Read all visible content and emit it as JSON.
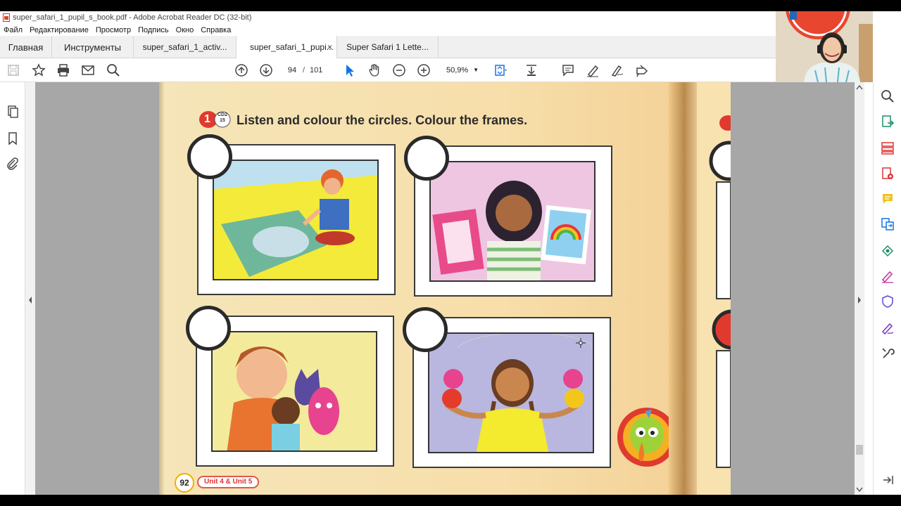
{
  "window": {
    "title": "super_safari_1_pupil_s_book.pdf - Adobe Acrobat Reader DC (32-bit)"
  },
  "menu": [
    "Файл",
    "Редактирование",
    "Просмотр",
    "Подпись",
    "Окно",
    "Справка"
  ],
  "tabs": {
    "home": "Главная",
    "tools": "Инструменты",
    "doc1": "super_safari_1_activ...",
    "doc2": "super_safari_1_pupi...",
    "doc2_close": "×",
    "doc3": "Super Safari 1 Lette..."
  },
  "toolbar": {
    "page_current": "94",
    "page_separator": "/",
    "page_total": "101",
    "zoom": "50,9%",
    "zoom_caret": "▼"
  },
  "page": {
    "exercise_number": "1",
    "cd_track": "CD2\n15",
    "instruction": "Listen and colour the circles. Colour the frames.",
    "page_number": "92",
    "unit_label": "Unit 4 & Unit 5"
  },
  "colors": {
    "accent_red": "#e03a2f",
    "adobe_blue": "#1473e6",
    "page_bg": "#f6dfae"
  }
}
